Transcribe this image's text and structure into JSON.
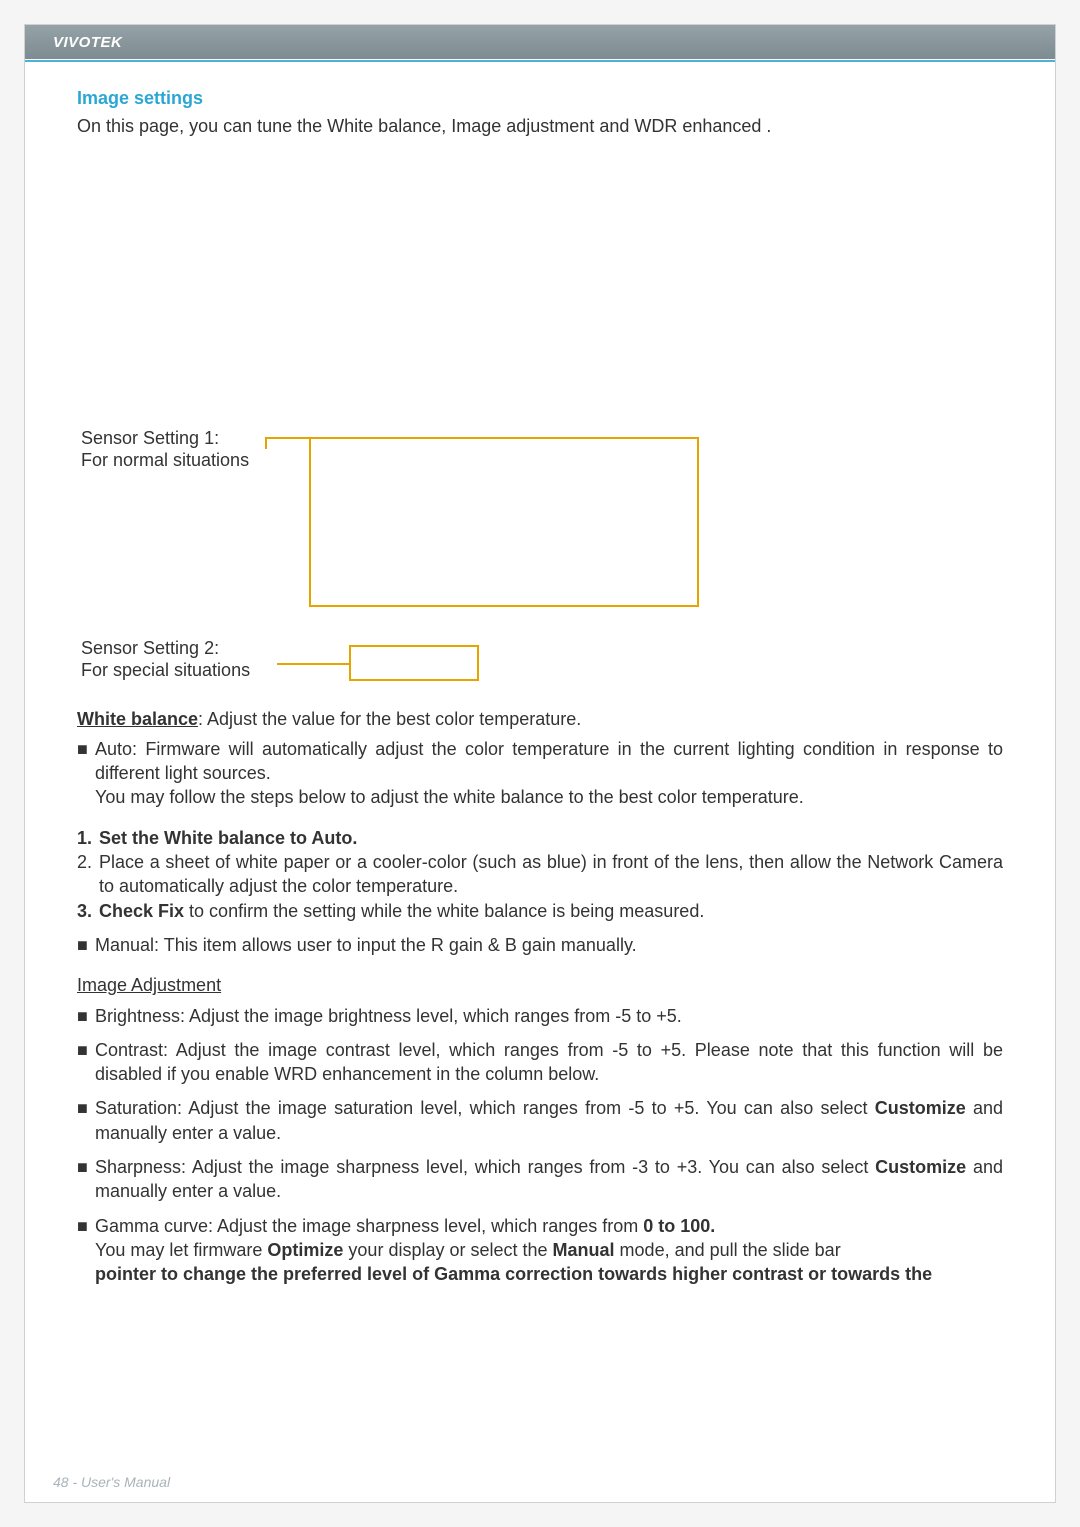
{
  "header": {
    "brand": "VIVOTEK"
  },
  "section": {
    "title": "Image settings",
    "intro": "On this page, you can tune the White balance, Image adjustment and WDR enhanced ."
  },
  "diagram": {
    "sensor1_l1": "Sensor Setting 1:",
    "sensor1_l2": "For normal situations",
    "sensor2_l1": "Sensor Setting 2:",
    "sensor2_l2": "For special situations"
  },
  "wb": {
    "heading": "White balance",
    "after": ": Adjust the value for the best color temperature.",
    "auto_line": "Auto: Firmware will automatically adjust the color temperature in the current lighting condition in response to different light sources.",
    "auto_follow": "You may follow the steps below to adjust the white balance to the best color temperature.",
    "step1_prefix": "1.",
    "step1_bold": "Set the White balance to Auto.",
    "step2_prefix": "2.",
    "step2_text": "Place a sheet of white paper or a cooler-color (such as blue) in front of the lens, then allow the Network Camera to automatically adjust the color temperature.",
    "step3_prefix": "3.",
    "step3_bold": "Check Fix",
    "step3_rest": " to confirm the setting while the white balance is being measured.",
    "manual": "Manual: This item allows user to input the R gain & B gain manually."
  },
  "img_adj": {
    "heading": "Image Adjustment",
    "brightness": "Brightness: Adjust the image brightness level, which ranges from -5 to +5.",
    "contrast": "Contrast: Adjust the image contrast level, which ranges from -5 to +5. Please note that this function will be disabled if you enable WRD enhancement in the column below.",
    "saturation_a": "Saturation: Adjust the image saturation level, which ranges from -5 to +5. You can also select ",
    "custom_bold": "Customize",
    "sat_b": " and manually enter a value.",
    "sharpness_a": "Sharpness: Adjust the image sharpness level, which ranges from -3 to +3. You can also select ",
    "gamma_a": "Gamma curve: Adjust the image sharpness level, which ranges from ",
    "gamma_range": "0 to 100",
    "gamma_period": ".",
    "gamma_line2a": "You may let firmware ",
    "gamma_opt": "Optimize",
    "gamma_line2b": " your display or select the ",
    "gamma_manual": "Manual",
    "gamma_line2c": " mode, and pull the slide bar",
    "gamma_line3": "pointer to change the preferred level of Gamma correction towards higher contrast or towards the"
  },
  "footer": {
    "text": "48 - User's Manual"
  }
}
